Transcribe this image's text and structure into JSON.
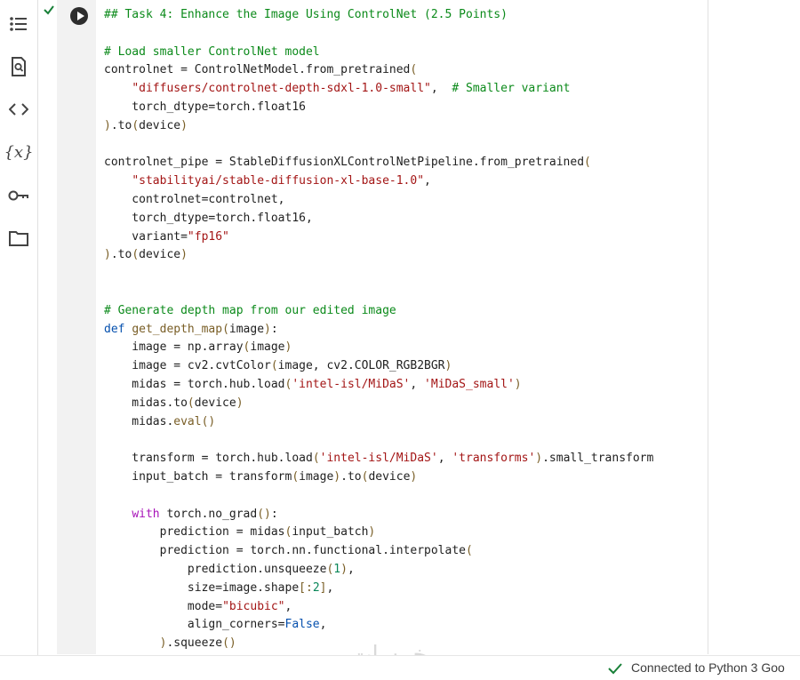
{
  "sidebar": {
    "icons": [
      {
        "name": "table-of-contents-icon",
        "label": ""
      },
      {
        "name": "find-replace-icon",
        "label": ""
      },
      {
        "name": "code-snippets-icon",
        "label": ""
      },
      {
        "name": "variables-icon",
        "label": "{x}"
      },
      {
        "name": "secrets-key-icon",
        "label": ""
      },
      {
        "name": "files-folder-icon",
        "label": ""
      }
    ]
  },
  "cell": {
    "executed": true,
    "lines": [
      [
        {
          "t": "## Task 4: Enhance the Image Using ControlNet (2.5 Points)",
          "c": "cm"
        }
      ],
      [],
      [
        {
          "t": "# Load smaller ControlNet model",
          "c": "cm"
        }
      ],
      [
        {
          "t": "controlnet = ControlNetModel.from_pretrained",
          "c": "pl"
        },
        {
          "t": "(",
          "c": "fn"
        }
      ],
      [
        {
          "t": "    ",
          "c": "pl"
        },
        {
          "t": "\"diffusers/controlnet-depth-sdxl-1.0-small\"",
          "c": "st"
        },
        {
          "t": ",  ",
          "c": "pl"
        },
        {
          "t": "# Smaller variant",
          "c": "cm"
        }
      ],
      [
        {
          "t": "    torch_dtype=torch.float16",
          "c": "pl"
        }
      ],
      [
        {
          "t": ")",
          "c": "fn"
        },
        {
          "t": ".to",
          "c": "pl"
        },
        {
          "t": "(",
          "c": "fn"
        },
        {
          "t": "device",
          "c": "pl"
        },
        {
          "t": ")",
          "c": "fn"
        }
      ],
      [],
      [
        {
          "t": "controlnet_pipe = StableDiffusionXLControlNetPipeline.from_pretrained",
          "c": "pl"
        },
        {
          "t": "(",
          "c": "fn"
        }
      ],
      [
        {
          "t": "    ",
          "c": "pl"
        },
        {
          "t": "\"stabilityai/stable-diffusion-xl-base-1.0\"",
          "c": "st"
        },
        {
          "t": ",",
          "c": "pl"
        }
      ],
      [
        {
          "t": "    controlnet=controlnet,",
          "c": "pl"
        }
      ],
      [
        {
          "t": "    torch_dtype=torch.float16,",
          "c": "pl"
        }
      ],
      [
        {
          "t": "    variant=",
          "c": "pl"
        },
        {
          "t": "\"fp16\"",
          "c": "st"
        }
      ],
      [
        {
          "t": ")",
          "c": "fn"
        },
        {
          "t": ".to",
          "c": "pl"
        },
        {
          "t": "(",
          "c": "fn"
        },
        {
          "t": "device",
          "c": "pl"
        },
        {
          "t": ")",
          "c": "fn"
        }
      ],
      [],
      [],
      [
        {
          "t": "# Generate depth map from our edited image",
          "c": "cm"
        }
      ],
      [
        {
          "t": "def ",
          "c": "bl"
        },
        {
          "t": "get_depth_map",
          "c": "fn"
        },
        {
          "t": "(",
          "c": "fn"
        },
        {
          "t": "image",
          "c": "pl"
        },
        {
          "t": ")",
          "c": "fn"
        },
        {
          "t": ":",
          "c": "pl"
        }
      ],
      [
        {
          "t": "    image = np.array",
          "c": "pl"
        },
        {
          "t": "(",
          "c": "fn"
        },
        {
          "t": "image",
          "c": "pl"
        },
        {
          "t": ")",
          "c": "fn"
        }
      ],
      [
        {
          "t": "    image = cv2.cvtColor",
          "c": "pl"
        },
        {
          "t": "(",
          "c": "fn"
        },
        {
          "t": "image, cv2.COLOR_RGB2BGR",
          "c": "pl"
        },
        {
          "t": ")",
          "c": "fn"
        }
      ],
      [
        {
          "t": "    midas = torch.hub.load",
          "c": "pl"
        },
        {
          "t": "(",
          "c": "fn"
        },
        {
          "t": "'intel-isl/MiDaS'",
          "c": "st"
        },
        {
          "t": ", ",
          "c": "pl"
        },
        {
          "t": "'MiDaS_small'",
          "c": "st"
        },
        {
          "t": ")",
          "c": "fn"
        }
      ],
      [
        {
          "t": "    midas.to",
          "c": "pl"
        },
        {
          "t": "(",
          "c": "fn"
        },
        {
          "t": "device",
          "c": "pl"
        },
        {
          "t": ")",
          "c": "fn"
        }
      ],
      [
        {
          "t": "    midas.",
          "c": "pl"
        },
        {
          "t": "eval",
          "c": "fn"
        },
        {
          "t": "()",
          "c": "fn"
        }
      ],
      [],
      [
        {
          "t": "    transform = torch.hub.load",
          "c": "pl"
        },
        {
          "t": "(",
          "c": "fn"
        },
        {
          "t": "'intel-isl/MiDaS'",
          "c": "st"
        },
        {
          "t": ", ",
          "c": "pl"
        },
        {
          "t": "'transforms'",
          "c": "st"
        },
        {
          "t": ")",
          "c": "fn"
        },
        {
          "t": ".small_transform",
          "c": "pl"
        }
      ],
      [
        {
          "t": "    input_batch = transform",
          "c": "pl"
        },
        {
          "t": "(",
          "c": "fn"
        },
        {
          "t": "image",
          "c": "pl"
        },
        {
          "t": ")",
          "c": "fn"
        },
        {
          "t": ".to",
          "c": "pl"
        },
        {
          "t": "(",
          "c": "fn"
        },
        {
          "t": "device",
          "c": "pl"
        },
        {
          "t": ")",
          "c": "fn"
        }
      ],
      [],
      [
        {
          "t": "    ",
          "c": "pl"
        },
        {
          "t": "with ",
          "c": "kw"
        },
        {
          "t": "torch.no_grad",
          "c": "pl"
        },
        {
          "t": "()",
          "c": "fn"
        },
        {
          "t": ":",
          "c": "pl"
        }
      ],
      [
        {
          "t": "        prediction = midas",
          "c": "pl"
        },
        {
          "t": "(",
          "c": "fn"
        },
        {
          "t": "input_batch",
          "c": "pl"
        },
        {
          "t": ")",
          "c": "fn"
        }
      ],
      [
        {
          "t": "        prediction = torch.nn.functional.interpolate",
          "c": "pl"
        },
        {
          "t": "(",
          "c": "fn"
        }
      ],
      [
        {
          "t": "            prediction.unsqueeze",
          "c": "pl"
        },
        {
          "t": "(",
          "c": "fn"
        },
        {
          "t": "1",
          "c": "nm"
        },
        {
          "t": ")",
          "c": "fn"
        },
        {
          "t": ",",
          "c": "pl"
        }
      ],
      [
        {
          "t": "            size=image.shape",
          "c": "pl"
        },
        {
          "t": "[:",
          "c": "fn"
        },
        {
          "t": "2",
          "c": "nm"
        },
        {
          "t": "]",
          "c": "fn"
        },
        {
          "t": ",",
          "c": "pl"
        }
      ],
      [
        {
          "t": "            mode=",
          "c": "pl"
        },
        {
          "t": "\"bicubic\"",
          "c": "st"
        },
        {
          "t": ",",
          "c": "pl"
        }
      ],
      [
        {
          "t": "            align_corners=",
          "c": "pl"
        },
        {
          "t": "False",
          "c": "bl"
        },
        {
          "t": ",",
          "c": "pl"
        }
      ],
      [
        {
          "t": "        ",
          "c": "pl"
        },
        {
          "t": ")",
          "c": "fn"
        },
        {
          "t": ".squeeze",
          "c": "pl"
        },
        {
          "t": "()",
          "c": "fn"
        }
      ]
    ]
  },
  "status": {
    "text": "Connected to Python 3 Goo"
  },
  "watermark": "خمسات",
  "colors": {
    "comment": "#0b8a1a",
    "string": "#a31515",
    "keyword": "#a713b8",
    "function": "#795e26",
    "builtin": "#0550ae",
    "number": "#098658",
    "success_check": "#188038"
  }
}
